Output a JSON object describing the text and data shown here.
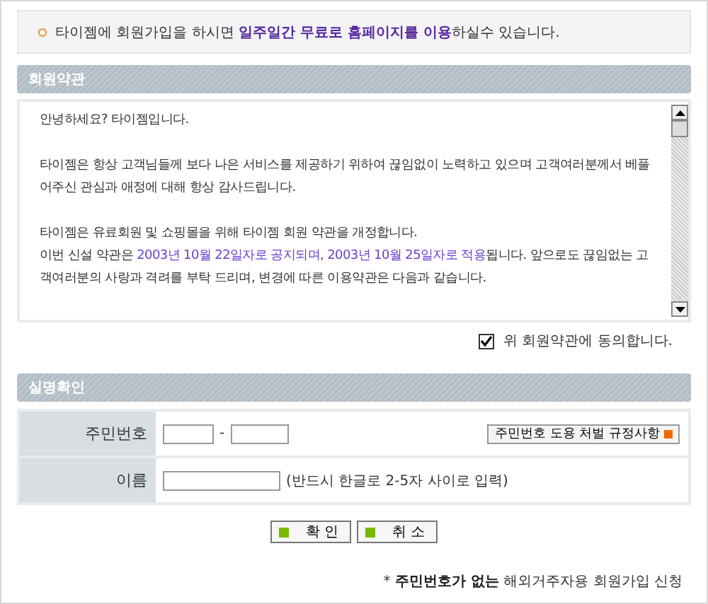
{
  "notice": "타이젬에 회원가입을 하시면 **일주일간 무료로 홈페이지를 이용**하실수 있습니다.",
  "terms": {
    "title": "회원약관",
    "paragraphs": [
      [
        [
          {
            "text": "안녕하세요? 타이젬입니다.",
            "highlight": false
          }
        ]
      ],
      [
        [
          {
            "text": "타이젬은 항상 고객님들께 보다 나은 서비스를 제공하기 위하여 끊임없이 노력하고 있으며 고객여러분께서 베풀어주신 관심과 애정에 대해 항상 감사드립니다.",
            "highlight": false
          }
        ]
      ],
      [
        [
          {
            "text": "타이젬은 유료회원 및 쇼핑몰을 위해 타이젬 회원 약관을 개정합니다.",
            "highlight": false
          }
        ],
        [
          {
            "text": "이번 신설 약관은 ",
            "highlight": false
          },
          {
            "text": "2003년 10월 22일자로 공지되며, 2003년 10월 25일자로 적용",
            "highlight": true
          },
          {
            "text": "됩니다. 앞으로도 끊임없는 고객여러분의 사랑과 격려를 부탁 드리며, 변경에 따른 이용약관은 다음과 같습니다.",
            "highlight": false
          }
        ]
      ]
    ],
    "agree": {
      "label": "위 회원약관에 동의합니다.",
      "checked": true
    }
  },
  "verify": {
    "title": "실명확인",
    "id_label": "주민번호",
    "dash": "-",
    "rules_button": "주민번호 도용 처벌 규정사항",
    "name_label": "이름",
    "name_hint": "(반드시 한글로 2-5자 사이로 입력)"
  },
  "buttons": [
    "확 인",
    "취 소"
  ],
  "footer": "* **주민번호가 없는** 해외거주자용 회원가입 신청"
}
